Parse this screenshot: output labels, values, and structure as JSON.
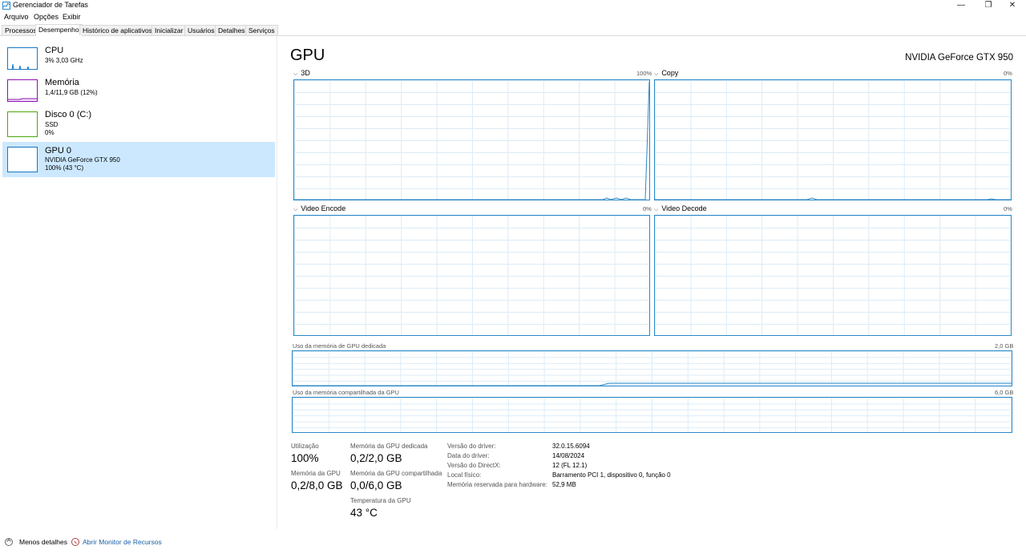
{
  "window": {
    "title": "Gerenciador de Tarefas",
    "minimize": "—",
    "maximize": "❐",
    "close": "✕"
  },
  "menu": [
    "Arquivo",
    "Opções",
    "Exibir"
  ],
  "tabs": [
    "Processos",
    "Desempenho",
    "Histórico de aplicativos",
    "Inicializar",
    "Usuários",
    "Detalhes",
    "Serviços"
  ],
  "active_tab": "Desempenho",
  "sidebar": {
    "items": [
      {
        "name": "CPU",
        "line1": "3% 3,03 GHz",
        "line2": "",
        "color": "#1777c4"
      },
      {
        "name": "Memória",
        "line1": "1,4/11,9 GB (12%)",
        "line2": "",
        "color": "#8b12ae"
      },
      {
        "name": "Disco 0 (C:)",
        "line1": "SSD",
        "line2": "0%",
        "color": "#4da60c"
      },
      {
        "name": "GPU 0",
        "line1": "NVIDIA GeForce GTX 950",
        "line2": "100% (43 °C)",
        "color": "#1777c4"
      }
    ]
  },
  "main": {
    "title": "GPU",
    "model": "NVIDIA GeForce GTX 950",
    "engines": [
      {
        "label": "3D",
        "max": "100%"
      },
      {
        "label": "Copy",
        "max": "0%"
      },
      {
        "label": "Video Encode",
        "max": "0%"
      },
      {
        "label": "Video Decode",
        "max": "0%"
      }
    ],
    "dedicated": {
      "label": "Uso da memória de GPU dedicada",
      "max": "2,0 GB"
    },
    "shared": {
      "label": "Uso da memória compartilhada da GPU",
      "max": "6,0 GB"
    }
  },
  "stats": {
    "utilization_label": "Utilização",
    "utilization": "100%",
    "gpu_mem_label": "Memória da GPU",
    "gpu_mem": "0,2/8,0 GB",
    "dedicated_label": "Memória da GPU dedicada",
    "dedicated": "0,2/2,0 GB",
    "shared_label": "Memória da GPU compartilhada",
    "shared": "0,0/6,0 GB",
    "temp_label": "Temperatura da GPU",
    "temp": "43 °C"
  },
  "info": [
    {
      "label": "Versão do driver:",
      "value": "32.0.15.6094"
    },
    {
      "label": "Data do driver:",
      "value": "14/08/2024"
    },
    {
      "label": "Versão do DirectX:",
      "value": "12 (FL 12.1)"
    },
    {
      "label": "Local físico:",
      "value": "Barramento PCI 1, dispositivo 0, função 0"
    },
    {
      "label": "Memória reservada para hardware:",
      "value": "52,9 MB"
    }
  ],
  "footer": {
    "less_details": "Menos detalhes",
    "resource_monitor": "Abrir Monitor de Recursos"
  },
  "colors": {
    "accent": "#2b8ac9",
    "selection": "#cce8ff"
  }
}
